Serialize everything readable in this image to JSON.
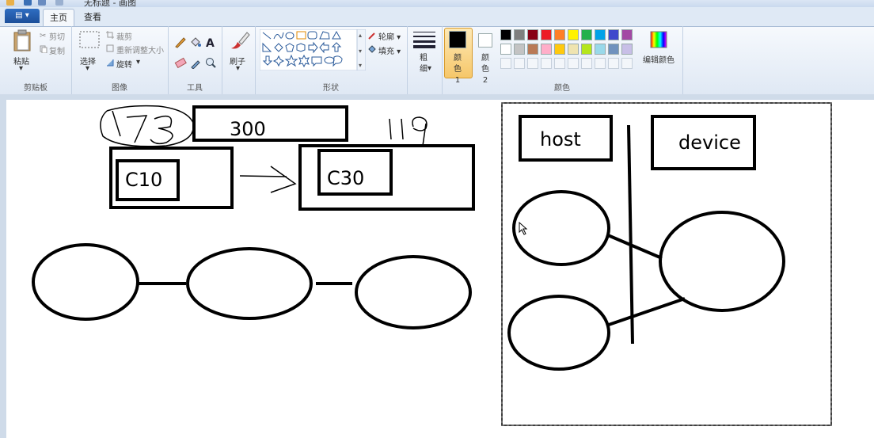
{
  "window": {
    "title": "无标题 - 画图"
  },
  "ribbon_tabs": {
    "file": "▤ ▾",
    "home": "主页",
    "view": "查看"
  },
  "clipboard": {
    "paste": "粘贴",
    "cut": "剪切",
    "copy": "复制",
    "group": "剪贴板"
  },
  "image": {
    "select": "选择",
    "crop": "裁剪",
    "resize": "重新调整大小",
    "rotate": "旋转",
    "group": "图像"
  },
  "tools": {
    "group": "工具"
  },
  "brushes": {
    "label": "刷子"
  },
  "shapes": {
    "outline": "轮廓",
    "fill": "填充",
    "group": "形状"
  },
  "size": {
    "label": "粗细"
  },
  "colors": {
    "color1": "颜色 1",
    "color2": "颜色 2",
    "edit": "编辑颜色",
    "group": "颜色",
    "color1_value": "#000000",
    "color2_value": "#ffffff",
    "palette_row1": [
      "#000000",
      "#7f7f7f",
      "#880015",
      "#ed1c24",
      "#ff7f27",
      "#fff200",
      "#22b14c",
      "#00a2e8",
      "#3f48cc",
      "#a349a4"
    ],
    "palette_row2": [
      "#ffffff",
      "#c3c3c3",
      "#b97a57",
      "#ffaec9",
      "#ffc90e",
      "#efe4b0",
      "#b5e61d",
      "#99d9ea",
      "#7092be",
      "#c8bfe7"
    ]
  },
  "drawing": {
    "handwritten_left": "173",
    "box_300": "300",
    "handwritten_right": "119",
    "c10": "C10",
    "c30": "C30",
    "host": "host",
    "device": "device"
  }
}
